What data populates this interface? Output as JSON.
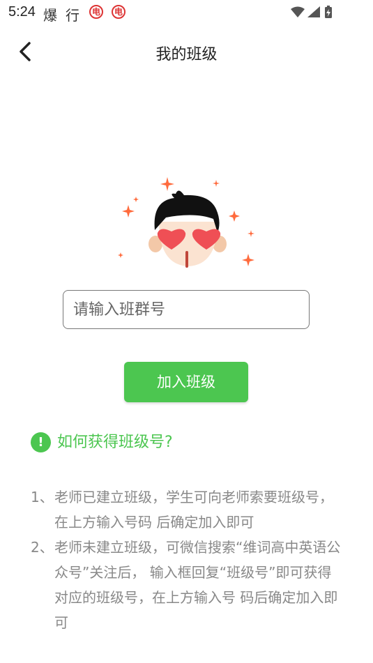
{
  "status_bar": {
    "time": "5:24",
    "app1": "爆",
    "app2": "行",
    "badge1": "电",
    "badge2": "电"
  },
  "header": {
    "title": "我的班级",
    "back_icon": "chevron-left-icon"
  },
  "form": {
    "input_placeholder": "请输入班群号",
    "join_button": "加入班级"
  },
  "help": {
    "icon": "!",
    "title": "如何获得班级号?"
  },
  "steps": [
    {
      "num": "1、",
      "text": "老师已建立班级，学生可向老师索要班级号，在上方输入号码 后确定加入即可"
    },
    {
      "num": "2、",
      "text": "老师未建立班级，可微信搜索“维词高中英语公众号”关注后， 输入框回复“班级号”即可获得对应的班级号，在上方输入号 码后确定加入即可"
    }
  ],
  "colors": {
    "accent": "#4cc650",
    "heart": "#ef4f55",
    "sparkle": "#ff6b3d"
  }
}
